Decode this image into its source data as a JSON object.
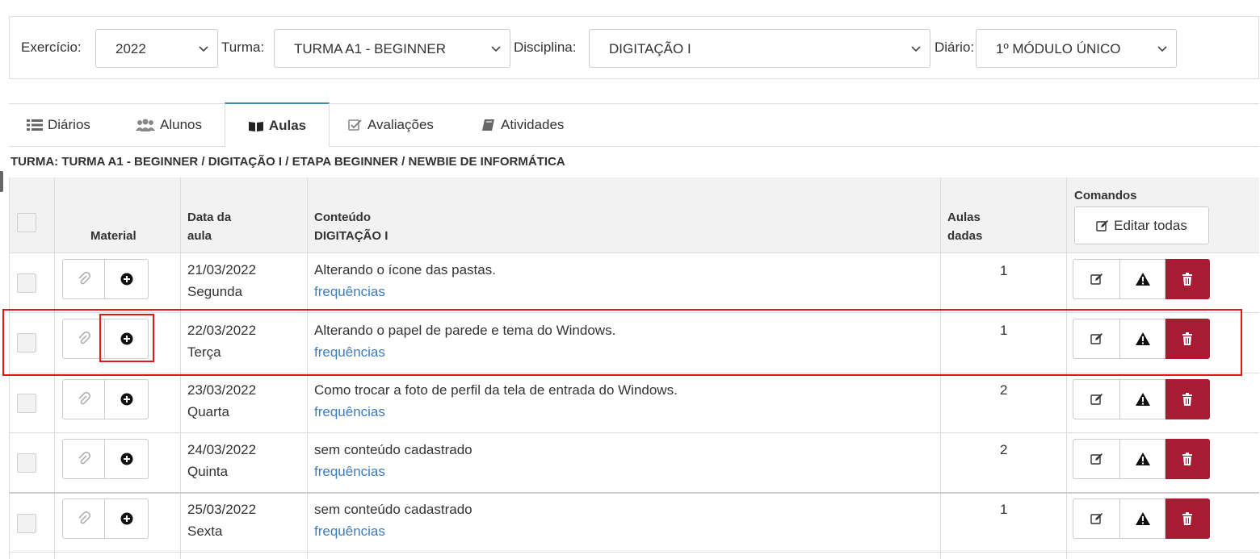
{
  "filters": {
    "exercicio_label": "Exercício:",
    "exercicio_value": "2022",
    "turma_label": "Turma:",
    "turma_value": "TURMA A1 - BEGINNER",
    "disciplina_label": "Disciplina:",
    "disciplina_value": "DIGITAÇÃO I",
    "diario_label": "Diário:",
    "diario_value": "1º MÓDULO ÚNICO"
  },
  "tabs": [
    {
      "label": "Diários",
      "icon": "list-icon"
    },
    {
      "label": "Alunos",
      "icon": "users-icon"
    },
    {
      "label": "Aulas",
      "icon": "book-icon",
      "active": true
    },
    {
      "label": "Avaliações",
      "icon": "check-square-icon"
    },
    {
      "label": "Atividades",
      "icon": "book-icon"
    }
  ],
  "turma_line": "TURMA: TURMA A1 - BEGINNER / DIGITAÇÃO I / ETAPA BEGINNER / NEWBIE DE INFORMÁTICA",
  "table": {
    "headers": {
      "material": "Material",
      "data_l1": "Data da",
      "data_l2": "aula",
      "conteudo_l1": "Conteúdo",
      "conteudo_l2": "DIGITAÇÃO I",
      "aulas_l1": "Aulas",
      "aulas_l2": "dadas",
      "comandos": "Comandos",
      "edit_all": "Editar todas"
    },
    "rows": [
      {
        "date": "21/03/2022",
        "weekday": "Segunda",
        "content": "Alterando o ícone das pastas.",
        "link": "frequências",
        "aulas": "1"
      },
      {
        "date": "22/03/2022",
        "weekday": "Terça",
        "content": "Alterando o papel de parede e tema do Windows.",
        "link": "frequências",
        "aulas": "1"
      },
      {
        "date": "23/03/2022",
        "weekday": "Quarta",
        "content": "Como trocar a foto de perfil da tela de entrada do Windows.",
        "link": "frequências",
        "aulas": "2"
      },
      {
        "date": "24/03/2022",
        "weekday": "Quinta",
        "content": "sem conteúdo cadastrado",
        "link": "frequências",
        "aulas": "2"
      },
      {
        "date": "25/03/2022",
        "weekday": "Sexta",
        "content": "sem conteúdo cadastrado",
        "link": "frequências",
        "aulas": "1"
      }
    ]
  },
  "colors": {
    "accent": "#3c8dbc",
    "link": "#3c7dbd",
    "danger": "#a91b33",
    "highlight": "#e8141a"
  }
}
